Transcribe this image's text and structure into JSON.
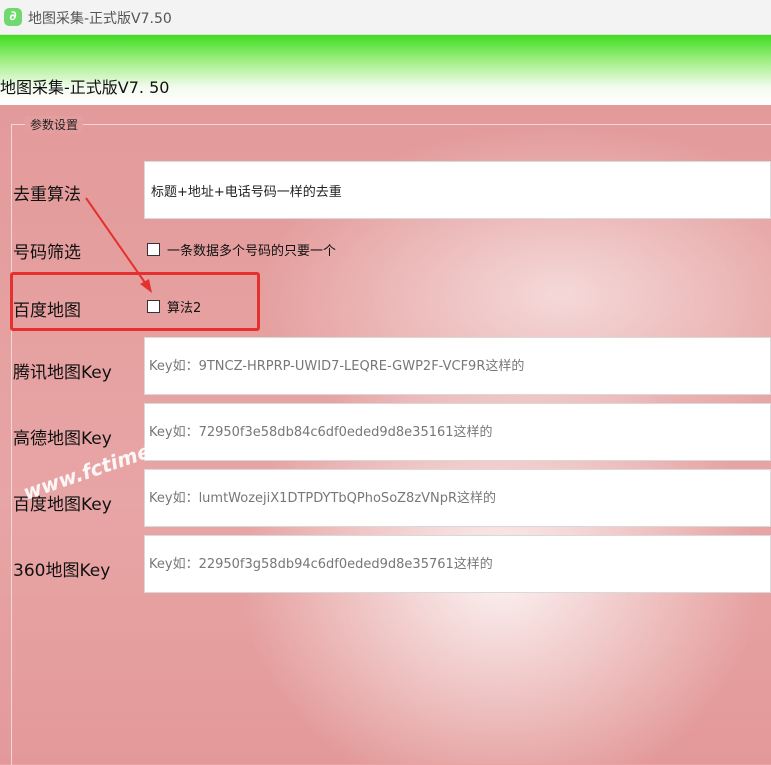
{
  "window": {
    "title": "地图采集-正式版V7.50",
    "app_icon": "leaf-icon"
  },
  "header": {
    "title": "地图采集-正式版V7. 50"
  },
  "params": {
    "group_label": "参数设置",
    "dedup": {
      "label": "去重算法",
      "value": "标题+地址+电话号码一样的去重"
    },
    "phone_filter": {
      "label": "号码筛选",
      "checkbox_label": "一条数据多个号码的只要一个",
      "checked": false
    },
    "baidu_map": {
      "label": "百度地图",
      "checkbox_label": "算法2",
      "checked": false
    },
    "tencent_key": {
      "label": "腾讯地图Key",
      "placeholder": "Key如：9TNCZ-HRPRP-UWID7-LEQRE-GWP2F-VCF9R这样的"
    },
    "gaode_key": {
      "label": "高德地图Key",
      "placeholder": "Key如：72950f3e58db84c6df0eded9d8e35161这样的"
    },
    "baidu_key": {
      "label": "百度地图Key",
      "placeholder": "Key如：lumtWozejiX1DTPDYTbQPhoSoZ8zVNpR这样的"
    },
    "key360": {
      "label": "360地图Key",
      "placeholder": "Key如：22950f3g58db94c6df0eded9d8e35761这样的"
    }
  },
  "watermark": "www.fctime.cn",
  "colors": {
    "header_green": "#3fdc20",
    "background_pink": "#e8a3a3",
    "highlight_red": "#e53030"
  }
}
